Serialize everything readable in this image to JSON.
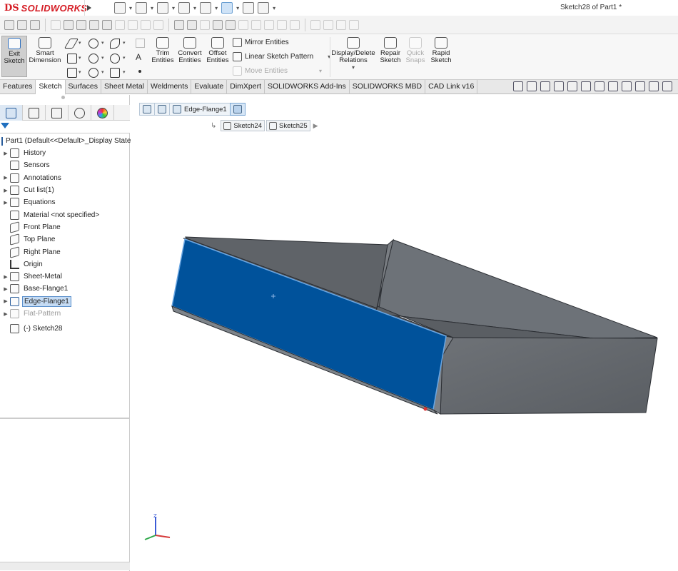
{
  "app": {
    "logo_ds": "DS",
    "logo_name": "SOLIDWORKS",
    "document_title": "Sketch28 of Part1 *"
  },
  "command_manager": {
    "exit_sketch": "Exit Sketch",
    "smart_dimension": "Smart Dimension",
    "trim_entities": "Trim Entities",
    "convert_entities": "Convert Entities",
    "offset_entities": "Offset Entities",
    "mirror_entities": "Mirror Entities",
    "linear_sketch_pattern": "Linear Sketch Pattern",
    "move_entities": "Move Entities",
    "display_delete_relations": "Display/Delete Relations",
    "repair_sketch": "Repair Sketch",
    "quick_snaps": "Quick Snaps",
    "rapid_sketch": "Rapid Sketch"
  },
  "tabs": [
    "Features",
    "Sketch",
    "Surfaces",
    "Sheet Metal",
    "Weldments",
    "Evaluate",
    "DimXpert",
    "SOLIDWORKS Add-Ins",
    "SOLIDWORKS MBD",
    "CAD Link v16"
  ],
  "active_tab": "Sketch",
  "tree": {
    "root": "Part1  (Default<<Default>_Display State",
    "items": [
      {
        "label": "History",
        "icon": "history-icon"
      },
      {
        "label": "Sensors",
        "icon": "sensors-icon"
      },
      {
        "label": "Annotations",
        "icon": "annotations-icon"
      },
      {
        "label": "Cut list(1)",
        "icon": "cut-list-icon"
      },
      {
        "label": "Equations",
        "icon": "equations-icon"
      },
      {
        "label": "Material <not specified>",
        "icon": "material-icon"
      },
      {
        "label": "Front Plane",
        "icon": "plane-icon"
      },
      {
        "label": "Top Plane",
        "icon": "plane-icon"
      },
      {
        "label": "Right Plane",
        "icon": "plane-icon"
      },
      {
        "label": "Origin",
        "icon": "origin-icon"
      },
      {
        "label": "Sheet-Metal",
        "icon": "sheet-metal-icon"
      },
      {
        "label": "Base-Flange1",
        "icon": "base-flange-icon"
      },
      {
        "label": "Edge-Flange1",
        "icon": "edge-flange-icon"
      },
      {
        "label": "Flat-Pattern",
        "icon": "flat-pattern-icon"
      },
      {
        "label": "(-) Sketch28",
        "icon": "sketch-icon"
      }
    ]
  },
  "breadcrumb": {
    "items": [
      "Edge-Flange1"
    ],
    "sketches": [
      "Sketch24",
      "Sketch25"
    ]
  },
  "colors": {
    "selected_face": "#00529b",
    "body_gray": "#5c6066",
    "accent": "#1f6fbf"
  }
}
